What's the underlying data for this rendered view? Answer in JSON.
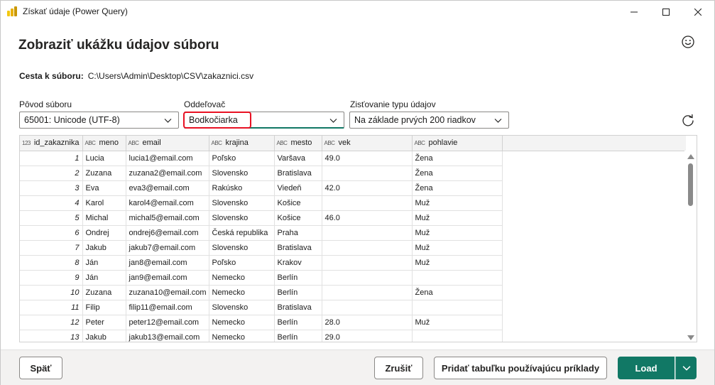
{
  "window": {
    "title": "Získať údaje (Power Query)",
    "icon": "power-bi-icon",
    "controls": [
      "minimize-icon",
      "maximize-icon",
      "close-icon"
    ]
  },
  "heading": "Zobraziť ukážku údajov súboru",
  "file_path": {
    "label": "Cesta k súboru:",
    "value": "C:\\Users\\Admin\\Desktop\\CSV\\zakaznici.csv"
  },
  "options": {
    "origin": {
      "label": "Pôvod súboru",
      "value": "65001: Unicode (UTF-8)"
    },
    "delimiter": {
      "label": "Oddeľovač",
      "value": "Bodkočiarka"
    },
    "type_detection": {
      "label": "Zisťovanie typu údajov",
      "value": "Na základe prvých 200 riadkov"
    }
  },
  "table": {
    "columns": [
      {
        "type": "123",
        "name": "id_zakaznika"
      },
      {
        "type": "ABC",
        "name": "meno"
      },
      {
        "type": "ABC",
        "name": "email"
      },
      {
        "type": "ABC",
        "name": "krajina"
      },
      {
        "type": "ABC",
        "name": "mesto"
      },
      {
        "type": "ABC",
        "name": "vek"
      },
      {
        "type": "ABC",
        "name": "pohlavie"
      }
    ],
    "rows": [
      [
        "1",
        "Lucia",
        "lucia1@email.com",
        "Poľsko",
        "Varšava",
        "49.0",
        "Žena"
      ],
      [
        "2",
        "Zuzana",
        "zuzana2@email.com",
        "Slovensko",
        "Bratislava",
        "",
        "Žena"
      ],
      [
        "3",
        "Eva",
        "eva3@email.com",
        "Rakúsko",
        "Viedeň",
        "42.0",
        "Žena"
      ],
      [
        "4",
        "Karol",
        "karol4@email.com",
        "Slovensko",
        "Košice",
        "",
        "Muž"
      ],
      [
        "5",
        "Michal",
        "michal5@email.com",
        "Slovensko",
        "Košice",
        "46.0",
        "Muž"
      ],
      [
        "6",
        "Ondrej",
        "ondrej6@email.com",
        "Česká republika",
        "Praha",
        "",
        "Muž"
      ],
      [
        "7",
        "Jakub",
        "jakub7@email.com",
        "Slovensko",
        "Bratislava",
        "",
        "Muž"
      ],
      [
        "8",
        "Ján",
        "jan8@email.com",
        "Poľsko",
        "Krakov",
        "",
        "Muž"
      ],
      [
        "9",
        "Ján",
        "jan9@email.com",
        "Nemecko",
        "Berlín",
        "",
        ""
      ],
      [
        "10",
        "Zuzana",
        "zuzana10@email.com",
        "Nemecko",
        "Berlín",
        "",
        "Žena"
      ],
      [
        "11",
        "Filip",
        "filip11@email.com",
        "Slovensko",
        "Bratislava",
        "",
        ""
      ],
      [
        "12",
        "Peter",
        "peter12@email.com",
        "Nemecko",
        "Berlín",
        "28.0",
        "Muž"
      ],
      [
        "13",
        "Jakub",
        "jakub13@email.com",
        "Nemecko",
        "Berlín",
        "29.0",
        ""
      ]
    ]
  },
  "footer": {
    "back": "Späť",
    "cancel": "Zrušiť",
    "add_table": "Pridať tabuľku používajúcu príklady",
    "load": "Load"
  },
  "colors": {
    "accent": "#117865",
    "highlight": "#e81123"
  }
}
